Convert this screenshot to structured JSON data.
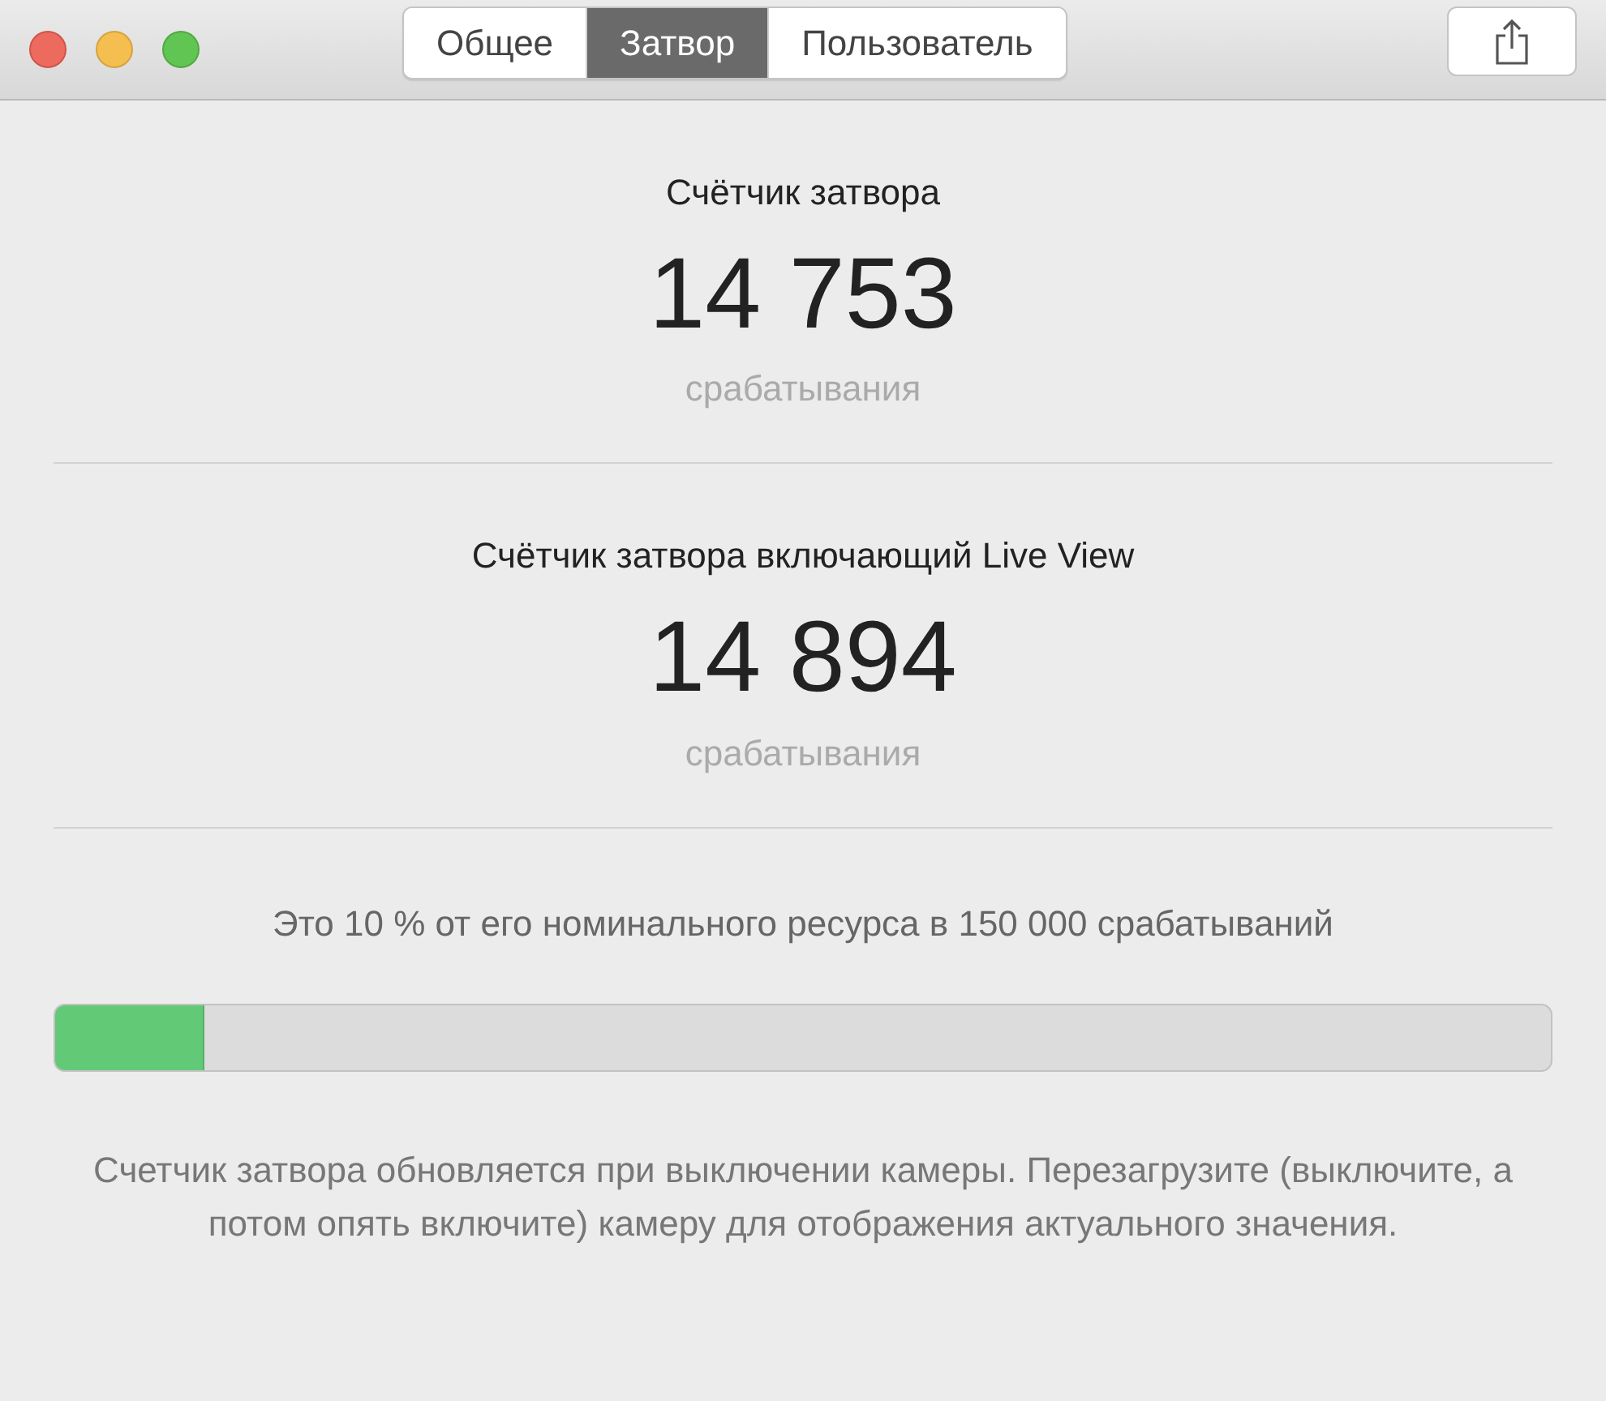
{
  "tabs": [
    {
      "label": "Общее",
      "selected": false
    },
    {
      "label": "Затвор",
      "selected": true
    },
    {
      "label": "Пользователь",
      "selected": false
    }
  ],
  "counters": [
    {
      "title": "Счётчик затвора",
      "value": "14 753",
      "unit": "срабатывания"
    },
    {
      "title": "Счётчик затвора включающий Live View",
      "value": "14 894",
      "unit": "срабатывания"
    }
  ],
  "resource": {
    "text": "Это 10 % от его номинального ресурса в 150 000 срабатываний",
    "level": 0.1
  },
  "note": "Счетчик затвора обновляется при выключении камеры. Перезагрузите (выключите, а потом опять включите) камеру для отображения актуального значения."
}
